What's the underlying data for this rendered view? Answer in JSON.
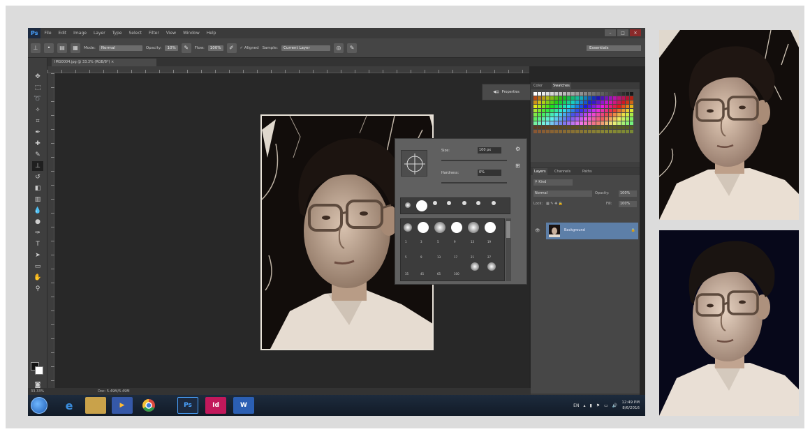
{
  "app": {
    "logo": "Ps",
    "menu": [
      "File",
      "Edit",
      "Image",
      "Layer",
      "Type",
      "Select",
      "Filter",
      "View",
      "Window",
      "Help"
    ],
    "window_controls": [
      "–",
      "□",
      "✕"
    ]
  },
  "options_bar": {
    "mode_label": "Mode:",
    "mode_value": "Normal",
    "opacity_label": "Opacity:",
    "opacity_value": "10%",
    "flow_label": "Flow:",
    "flow_value": "100%",
    "aligned_label": "Aligned",
    "sample_label": "Sample:",
    "sample_value": "Current Layer",
    "workspace": "Essentials"
  },
  "document": {
    "tab_title": "IMG0004.jpg @ 33.3% (RGB/8*)",
    "zoom": "33.33%",
    "doc_size": "Doc: 5.49M/5.49M"
  },
  "brush_picker": {
    "size_label": "Size:",
    "size_value": "100 px",
    "hardness_label": "Hardness:",
    "hardness_value": "0%",
    "preset_labels": [
      "1",
      "3",
      "5",
      "9",
      "13",
      "19",
      "5",
      "9",
      "13",
      "17",
      "21",
      "27",
      "35",
      "45",
      "65",
      "100",
      "200",
      "300",
      "14",
      "24"
    ]
  },
  "properties_button": "Properties",
  "swatches": {
    "tabs": [
      "Color",
      "Swatches"
    ]
  },
  "layers": {
    "tabs": [
      "Layers",
      "Channels",
      "Paths"
    ],
    "kind_label": "Kind",
    "blend_mode": "Normal",
    "opacity_label": "Opacity:",
    "opacity_value": "100%",
    "lock_label": "Lock:",
    "fill_label": "Fill:",
    "fill_value": "100%",
    "layer_name": "Background",
    "lock_icon_name": "lock-icon"
  },
  "taskbar": {
    "language": "EN",
    "time": "12:49 PM",
    "date": "8/6/2016"
  },
  "colors": {
    "ps_blue": "#4aa3ff",
    "layer_selected": "#5d7fa8",
    "indesign": "#c2185b",
    "word": "#2b5fb3"
  }
}
